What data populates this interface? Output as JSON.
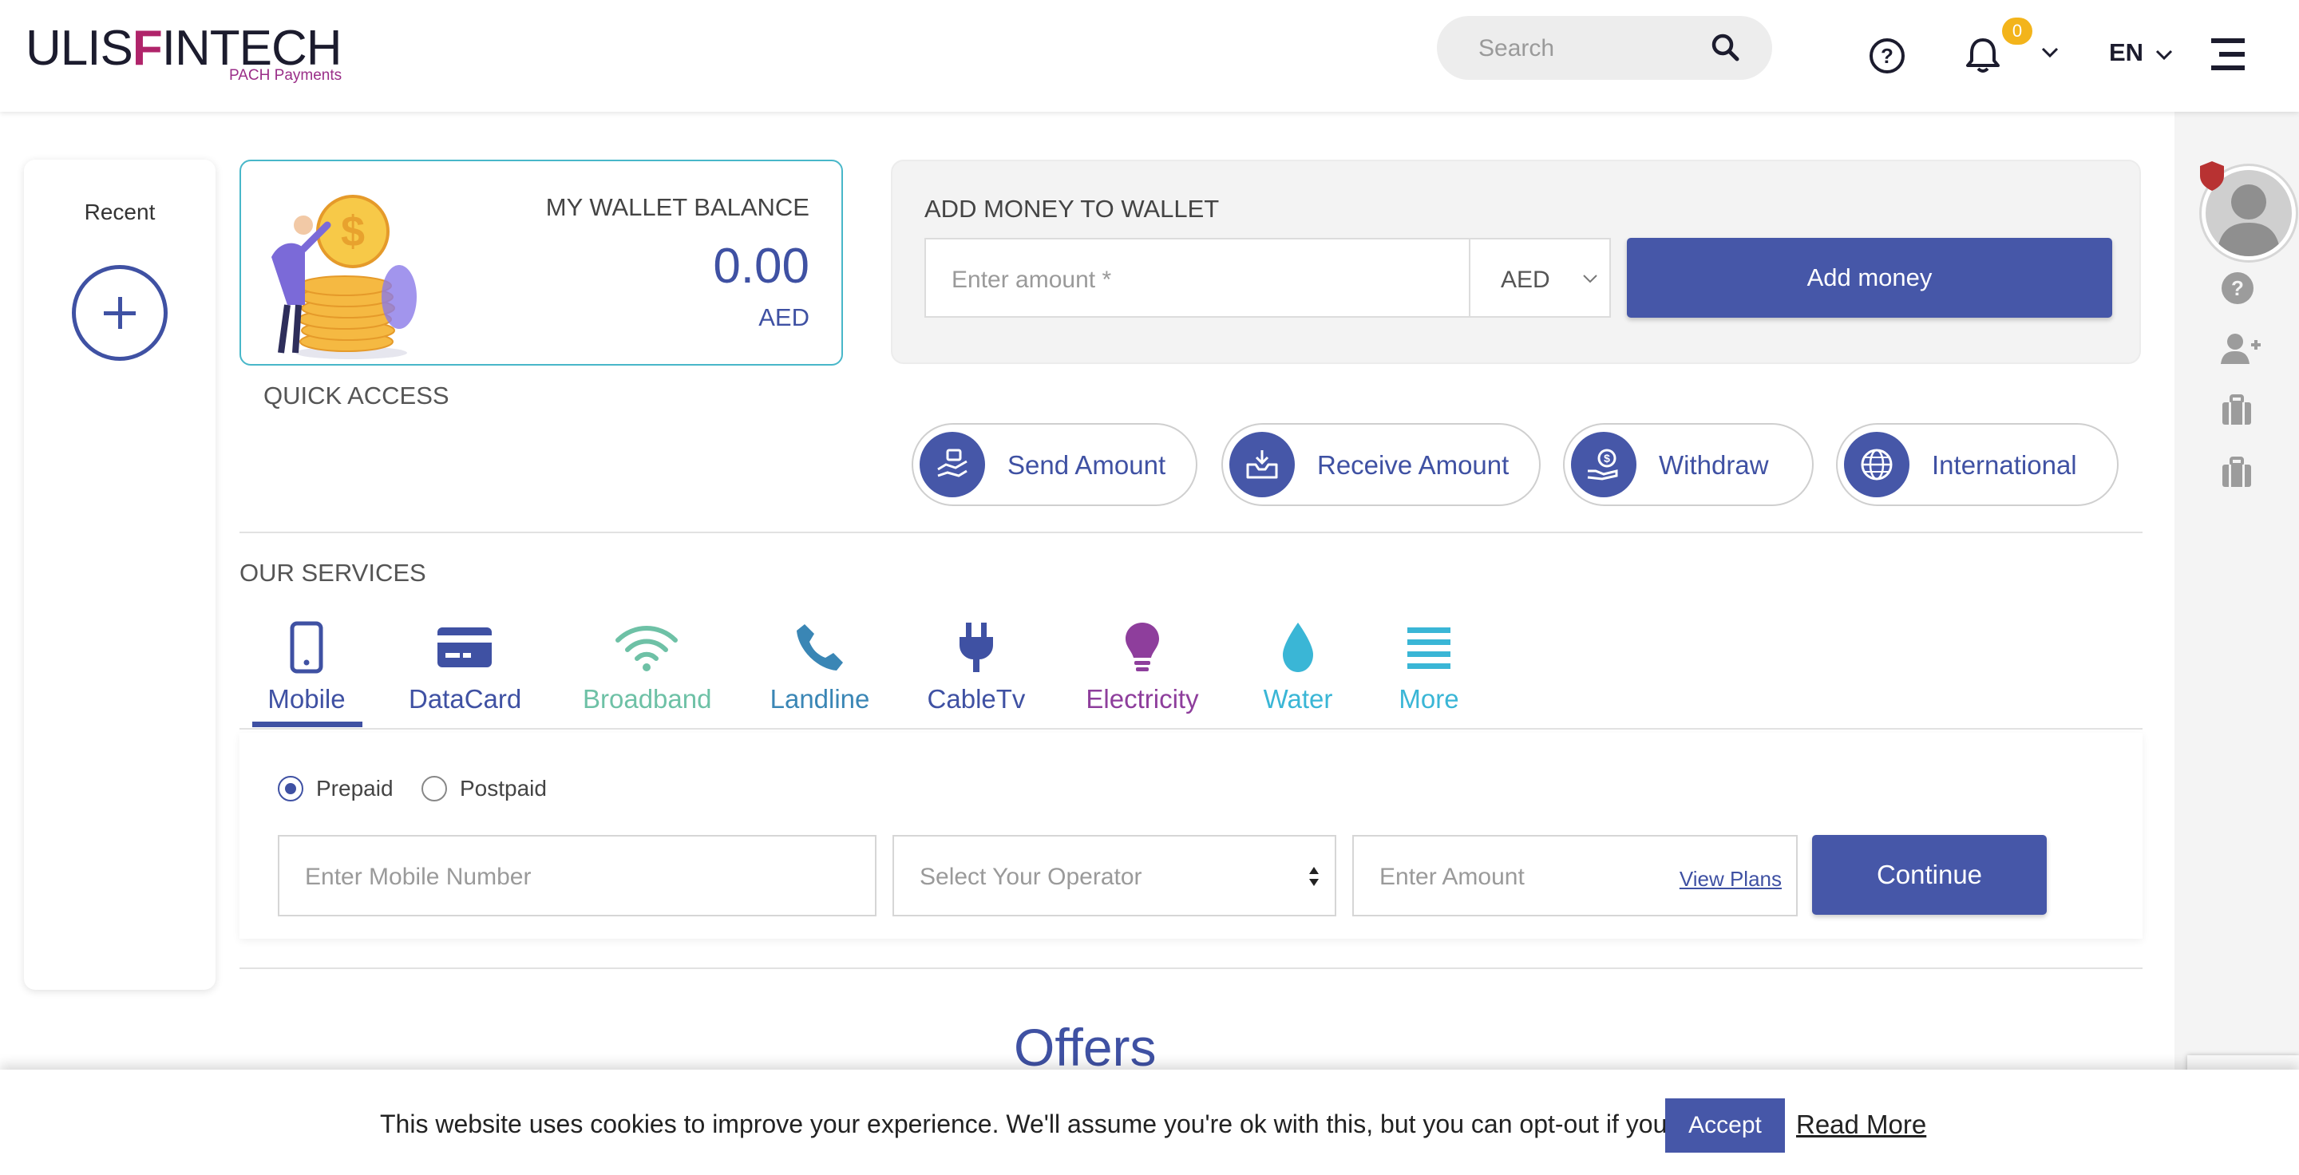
{
  "header": {
    "logo_text_left": "ULIS",
    "logo_text_right": "INTECH",
    "logo_sub": "PACH Payments",
    "search_placeholder": "Search",
    "notification_count": "0",
    "language": "EN"
  },
  "recent": {
    "title": "Recent"
  },
  "wallet": {
    "title": "MY WALLET BALANCE",
    "amount": "0.00",
    "currency": "AED"
  },
  "add_money": {
    "title": "ADD MONEY TO WALLET",
    "amount_placeholder": "Enter amount *",
    "currency": "AED",
    "button": "Add money"
  },
  "quick_access": {
    "title": "QUICK ACCESS",
    "items": [
      {
        "label": "Send Amount",
        "icon": "send-money-icon"
      },
      {
        "label": "Receive Amount",
        "icon": "receive-tray-icon"
      },
      {
        "label": "Withdraw",
        "icon": "withdraw-hand-icon"
      },
      {
        "label": "International",
        "icon": "globe-icon"
      }
    ]
  },
  "services": {
    "title": "OUR SERVICES",
    "items": [
      {
        "label": "Mobile",
        "color": "#3f51a3",
        "icon": "mobile-icon"
      },
      {
        "label": "DataCard",
        "color": "#3f51a3",
        "icon": "datacard-icon"
      },
      {
        "label": "Broadband",
        "color": "#6ec1a6",
        "icon": "wifi-icon"
      },
      {
        "label": "Landline",
        "color": "#3a86b5",
        "icon": "phone-icon"
      },
      {
        "label": "CableTv",
        "color": "#3f51a3",
        "icon": "plug-icon"
      },
      {
        "label": "Electricity",
        "color": "#8e3e9c",
        "icon": "bulb-icon"
      },
      {
        "label": "Water",
        "color": "#3ab6d6",
        "icon": "water-drop-icon"
      },
      {
        "label": "More",
        "color": "#3ab6d6",
        "icon": "menu-lines-icon"
      }
    ],
    "selected": "Mobile"
  },
  "mobile_form": {
    "prepaid_label": "Prepaid",
    "postpaid_label": "Postpaid",
    "selected_plan": "Prepaid",
    "mobile_placeholder": "Enter Mobile Number",
    "operator_placeholder": "Select Your Operator",
    "amount_placeholder": "Enter Amount",
    "view_plans": "View Plans",
    "continue": "Continue"
  },
  "offers": {
    "title": "Offers"
  },
  "cookie": {
    "message": "This website uses cookies to improve your experience. We'll assume you're ok with this, but you can opt-out if you wish.",
    "accept": "Accept",
    "read_more": "Read More"
  },
  "colors": {
    "primary": "#4657a8",
    "accent_teal": "#48b7c9",
    "badge": "#f3b41b"
  }
}
